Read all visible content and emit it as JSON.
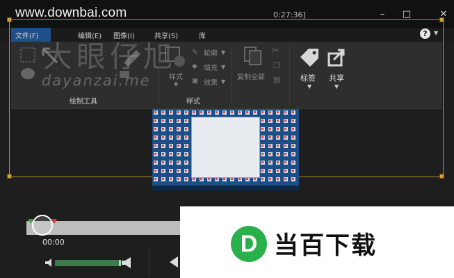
{
  "titlebar": {
    "watermark": "www.downbai.com",
    "time": "0:27:36]",
    "minimize": "–",
    "maximize": "□",
    "close": "✕"
  },
  "menu": {
    "items": [
      "文件(F)",
      "编辑(E)",
      "图像(I)",
      "共享(S)",
      "库"
    ],
    "help": "?"
  },
  "ribbon": {
    "groups": {
      "draw": "绘制工具",
      "style": "样式"
    },
    "style_btn": "样式",
    "outline": "轮廓",
    "fill": "填充",
    "effects": "效果",
    "copy_all": "复制全部",
    "tag": "标签",
    "share": "共享"
  },
  "overlay": {
    "cn": "大眼仔旭",
    "en": "dayanzai.me"
  },
  "player": {
    "time": "00:00"
  },
  "brand": {
    "letter": "D",
    "name": "当百下载"
  },
  "colors": {
    "accent": "#1f4f8a",
    "frame": "#b38f2a",
    "brand_green": "#29b04b"
  }
}
